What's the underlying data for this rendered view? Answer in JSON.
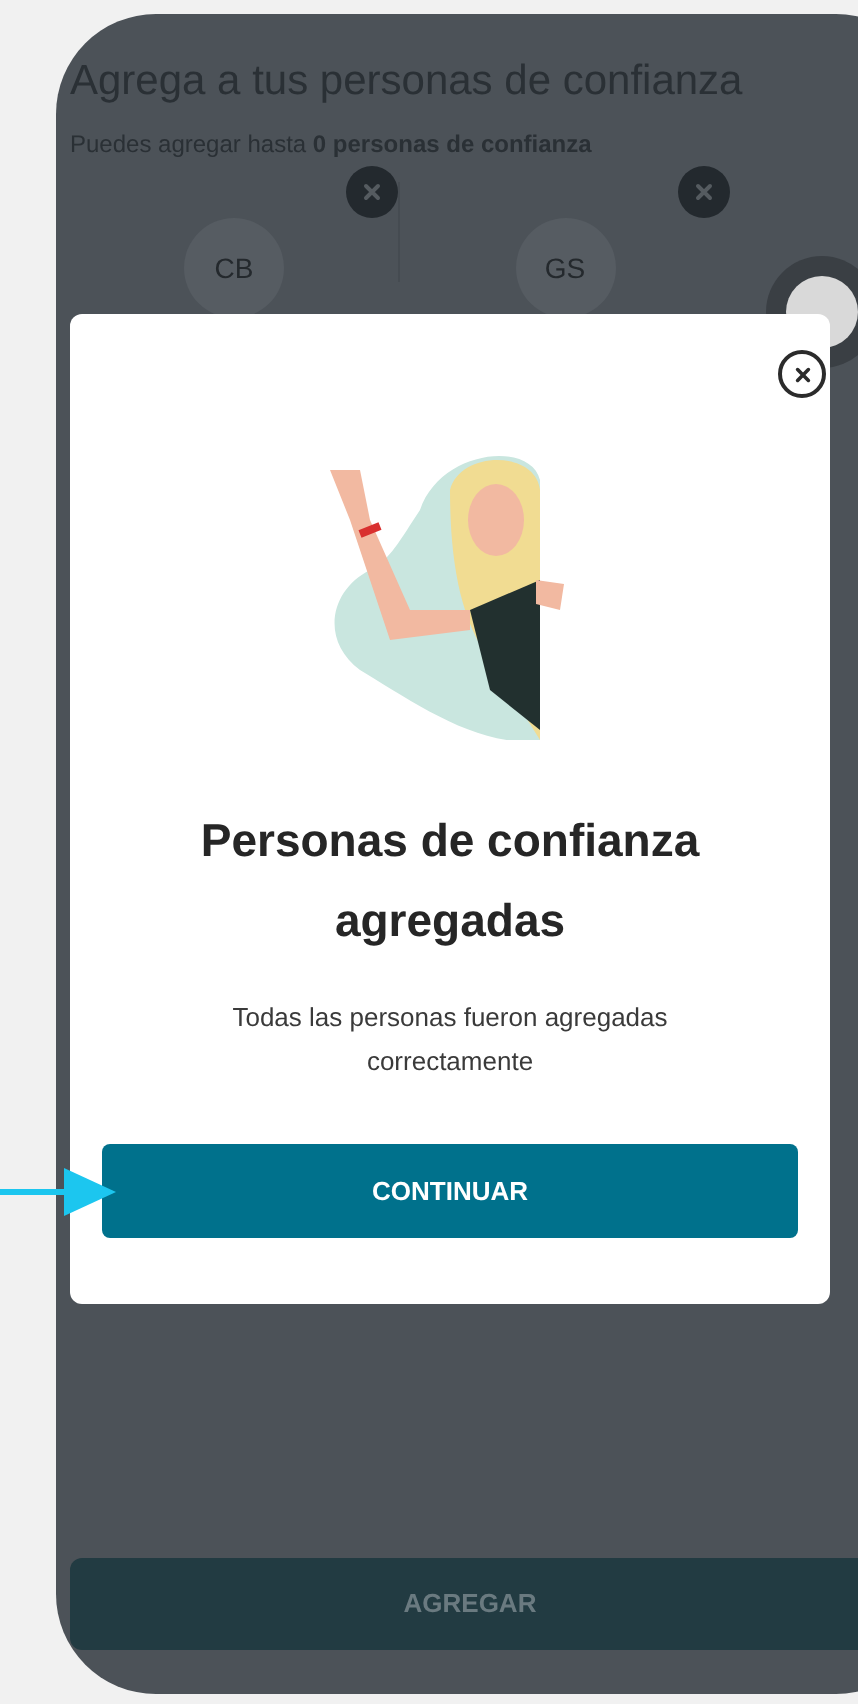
{
  "background_screen": {
    "title": "Agrega a tus personas de confianza",
    "subtitle": "Puedes agregar hasta **0 personas de confianza**",
    "contacts": [
      {
        "initials": "CB"
      },
      {
        "initials": "GS"
      }
    ],
    "add_button": {
      "label": "AGREGAR",
      "disabled": true
    }
  },
  "dialog": {
    "title": "Personas de confianza agregadas",
    "message": "Todas las personas fueron agregadas correctamente",
    "button": "CONTINUAR"
  }
}
